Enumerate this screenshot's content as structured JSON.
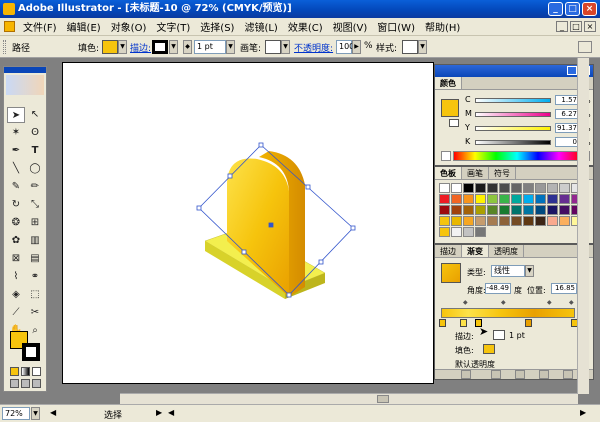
{
  "window": {
    "title": "Adobe Illustrator - [未标题-10 @ 72% (CMYK/预览)]",
    "minimize": "_",
    "restore": "□",
    "close": "×"
  },
  "menu": [
    "文件(F)",
    "编辑(E)",
    "对象(O)",
    "文字(T)",
    "选择(S)",
    "滤镜(L)",
    "效果(C)",
    "视图(V)",
    "窗口(W)",
    "帮助(H)"
  ],
  "control": {
    "path": "路径",
    "fill": "填色:",
    "stroke": "描边:",
    "stroke_weight": "1 pt",
    "brush": "画笔:",
    "opacity": "不透明度:",
    "opacity_value": "100",
    "percent": "%",
    "style": "样式:"
  },
  "colors": {
    "fill": "#f6c40d",
    "stroke": "#000000",
    "accent": "#0a46b8"
  },
  "color_panel": {
    "tab": "颜色",
    "channels": [
      {
        "label": "C",
        "value": "1.57",
        "unit": "%",
        "gradient": "linear-gradient(90deg,#fff,#00aeef)"
      },
      {
        "label": "M",
        "value": "6.27",
        "unit": "%",
        "gradient": "linear-gradient(90deg,#fff,#ec008c)"
      },
      {
        "label": "Y",
        "value": "91.37",
        "unit": "%",
        "gradient": "linear-gradient(90deg,#fff,#fff200)"
      },
      {
        "label": "K",
        "value": "0",
        "unit": "%",
        "gradient": "linear-gradient(90deg,#fff,#000)"
      }
    ]
  },
  "swatches_panel": {
    "tabs": [
      "色板",
      "画笔",
      "符号"
    ],
    "rows": [
      [
        "#ffffff",
        "#ffffff",
        "#000000",
        "#1a1a1a",
        "#333333",
        "#4d4d4d",
        "#666666",
        "#808080",
        "#999999",
        "#b3b3b3",
        "#cccccc",
        "#e6e6e6"
      ],
      [
        "#ed1c24",
        "#f26522",
        "#f7941d",
        "#fff200",
        "#8dc63f",
        "#39b54a",
        "#00a99d",
        "#00aeef",
        "#0072bc",
        "#2e3192",
        "#662d91",
        "#92278f"
      ],
      [
        "#9e0b0f",
        "#a0410d",
        "#a36209",
        "#aba000",
        "#598527",
        "#197b30",
        "#00746b",
        "#0076a3",
        "#004a80",
        "#1b1464",
        "#440e62",
        "#630460"
      ],
      [
        "#f6c40d",
        "#e8b700",
        "#f5a623",
        "#c69c6d",
        "#a67c52",
        "#8c6239",
        "#754c24",
        "#603913",
        "#3c2415",
        "#f9a98e",
        "#fbaf5d",
        "#fff799"
      ],
      [
        "#f6c40d",
        "#f2f2f2",
        "#c2c2c2",
        "#777777"
      ]
    ]
  },
  "gradient_panel": {
    "tabs": [
      "描边",
      "渐变",
      "透明度"
    ],
    "type_label": "类型:",
    "type_value": "线性",
    "angle_label": "角度:",
    "angle_value": "-48.49",
    "degree": "度",
    "position_label": "位置:",
    "position_value": "16.85",
    "percent": "%",
    "stroke_row": "描边:",
    "stroke_weight": "1 pt",
    "fill_row": "填色:",
    "default_opacity": "默认透明度"
  },
  "status": {
    "zoom": "72%",
    "mode": "选择"
  }
}
